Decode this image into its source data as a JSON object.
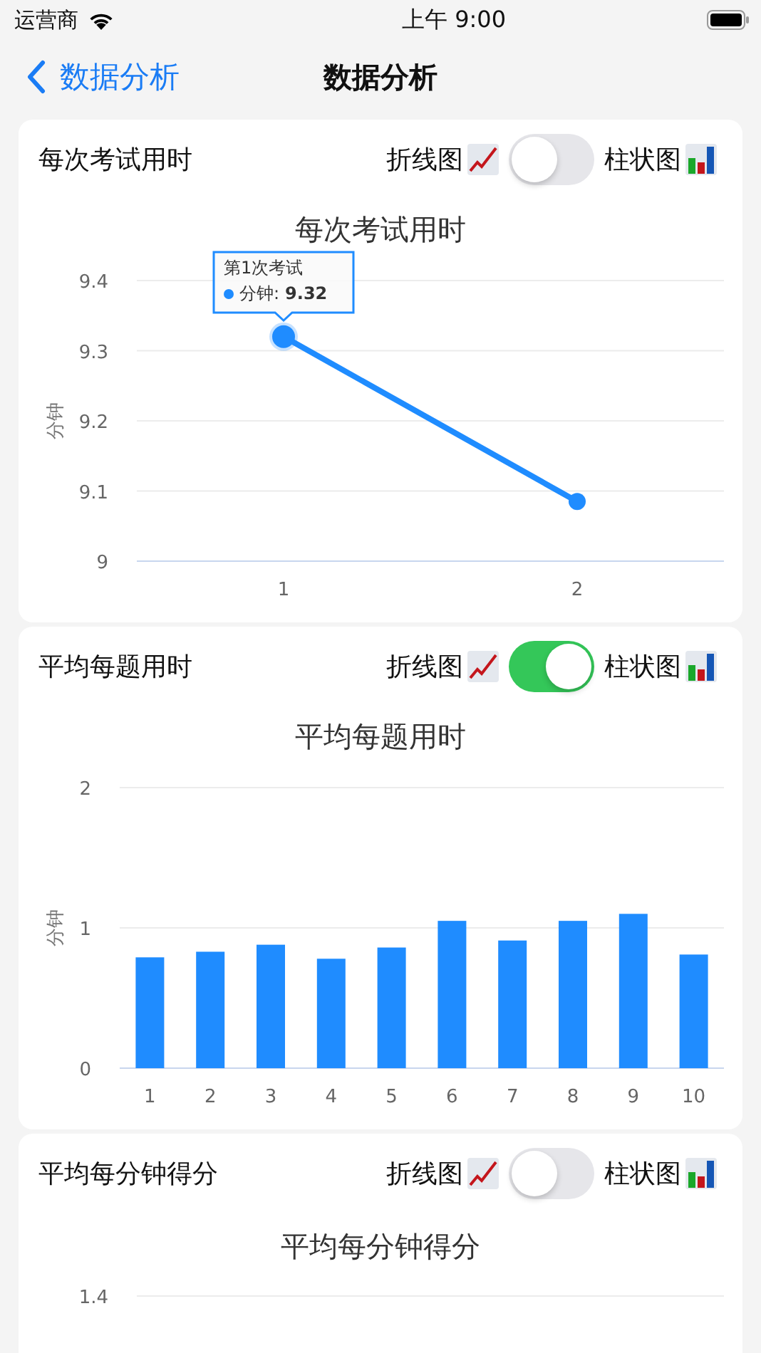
{
  "status_bar": {
    "carrier": "运营商",
    "time": "上午 9:00"
  },
  "nav": {
    "back": "数据分析",
    "title": "数据分析"
  },
  "cards": [
    {
      "title": "每次考试用时",
      "line_label": "折线图",
      "bar_label": "柱状图",
      "switch_on": false,
      "chart_data": {
        "type": "line",
        "title": "每次考试用时",
        "ylabel": "分钟",
        "categories": [
          "1",
          "2"
        ],
        "series": [
          {
            "color": "#1f8cff",
            "values": [
              9.32,
              9.085
            ],
            "marker": true
          }
        ],
        "ylim": [
          9,
          9.4
        ],
        "yticks": [
          9,
          9.1,
          9.2,
          9.3,
          9.4
        ],
        "grid": true
      },
      "tooltip": {
        "point": "1",
        "title": "第1次考试",
        "label": "分钟:",
        "value": "9.32"
      }
    },
    {
      "title": "平均每题用时",
      "line_label": "折线图",
      "bar_label": "柱状图",
      "switch_on": true,
      "chart_data": {
        "type": "bar",
        "title": "平均每题用时",
        "ylabel": "分钟",
        "categories": [
          "1",
          "2",
          "3",
          "4",
          "5",
          "6",
          "7",
          "8",
          "9",
          "10"
        ],
        "series": [
          {
            "color": "#1f8cff",
            "values": [
              0.79,
              0.83,
              0.88,
              0.78,
              0.86,
              1.05,
              0.91,
              1.05,
              1.1,
              0.81
            ]
          }
        ],
        "ylim": [
          0,
          2
        ],
        "yticks": [
          0,
          1,
          2
        ],
        "grid": true
      }
    },
    {
      "title": "平均每分钟得分",
      "line_label": "折线图",
      "bar_label": "柱状图",
      "switch_on": false,
      "chart_title": "平均每分钟得分",
      "tick_label": "1.4"
    }
  ]
}
